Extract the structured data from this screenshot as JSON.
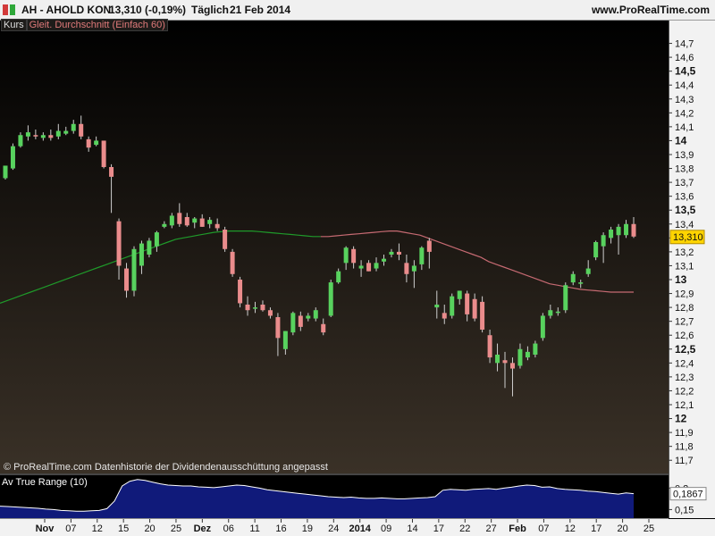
{
  "header": {
    "symbol": "AH - AHOLD KON",
    "quote": "13,310 (-0,19%)",
    "period": "Täglich",
    "date": "21 Feb 2014",
    "site": "www.ProRealTime.com"
  },
  "legend": {
    "price_label": "Kurs",
    "ma_label": "Gleit. Durchschnitt (Einfach 60)"
  },
  "footer": {
    "copyright": "© ProRealTime.com  Datenhistorie der Dividendenausschüttung angepasst"
  },
  "colors": {
    "up": "#58d25e",
    "down": "#ea8c8c",
    "ma_green": "#1f9a2a",
    "ma_red": "#c66a72",
    "highlight": "#ffd400",
    "atr_fill": "#101a7a",
    "atr_line": "#ffffff"
  },
  "chart_data": [
    {
      "type": "candlestick",
      "ylim": [
        11.65,
        14.8
      ],
      "y_ticks": [
        "14,7",
        "14,6",
        "14,5",
        "14,4",
        "14,3",
        "14,2",
        "14,1",
        "14",
        "13,9",
        "13,8",
        "13,7",
        "13,6",
        "13,5",
        "13,4",
        "13,3",
        "13,2",
        "13,1",
        "13",
        "12,9",
        "12,8",
        "12,7",
        "12,6",
        "12,5",
        "12,4",
        "12,3",
        "12,2",
        "12,1",
        "12",
        "11,9",
        "11,8",
        "11,7"
      ],
      "major_ticks": [
        "14,5",
        "14",
        "13,5",
        "13",
        "12,5",
        "12"
      ],
      "last_price": "13,310",
      "last_price_value": 13.31,
      "x_labels": [
        "Nov",
        "07",
        "12",
        "15",
        "20",
        "25",
        "Dez",
        "06",
        "11",
        "16",
        "19",
        "24",
        "2014",
        "09",
        "14",
        "17",
        "22",
        "27",
        "Feb",
        "07",
        "12",
        "17",
        "20",
        "25"
      ],
      "major_x_labels": [
        "Nov",
        "Dez",
        "2014",
        "Feb"
      ],
      "candles": [
        {
          "o": 13.73,
          "h": 13.82,
          "l": 13.72,
          "c": 13.82
        },
        {
          "o": 13.8,
          "h": 13.98,
          "l": 13.79,
          "c": 13.96
        },
        {
          "o": 13.96,
          "h": 14.06,
          "l": 13.95,
          "c": 14.04
        },
        {
          "o": 14.03,
          "h": 14.11,
          "l": 14.0,
          "c": 14.06
        },
        {
          "o": 14.04,
          "h": 14.08,
          "l": 14.01,
          "c": 14.03
        },
        {
          "o": 14.02,
          "h": 14.06,
          "l": 14.0,
          "c": 14.04
        },
        {
          "o": 14.04,
          "h": 14.08,
          "l": 14.0,
          "c": 14.02
        },
        {
          "o": 14.03,
          "h": 14.12,
          "l": 14.01,
          "c": 14.07
        },
        {
          "o": 14.05,
          "h": 14.1,
          "l": 14.04,
          "c": 14.07
        },
        {
          "o": 14.07,
          "h": 14.15,
          "l": 14.05,
          "c": 14.12
        },
        {
          "o": 14.12,
          "h": 14.18,
          "l": 14.01,
          "c": 14.03
        },
        {
          "o": 14.01,
          "h": 14.03,
          "l": 13.92,
          "c": 13.95
        },
        {
          "o": 13.97,
          "h": 14.03,
          "l": 13.96,
          "c": 14.0
        },
        {
          "o": 14.0,
          "h": 14.0,
          "l": 13.8,
          "c": 13.81
        },
        {
          "o": 13.81,
          "h": 13.83,
          "l": 13.48,
          "c": 13.74
        },
        {
          "o": 13.42,
          "h": 13.44,
          "l": 13.0,
          "c": 13.1
        },
        {
          "o": 13.08,
          "h": 13.12,
          "l": 12.87,
          "c": 12.92
        },
        {
          "o": 12.92,
          "h": 13.24,
          "l": 12.88,
          "c": 13.22
        },
        {
          "o": 13.1,
          "h": 13.28,
          "l": 13.04,
          "c": 13.26
        },
        {
          "o": 13.18,
          "h": 13.3,
          "l": 13.16,
          "c": 13.28
        },
        {
          "o": 13.24,
          "h": 13.35,
          "l": 13.2,
          "c": 13.34
        },
        {
          "o": 13.38,
          "h": 13.42,
          "l": 13.37,
          "c": 13.4
        },
        {
          "o": 13.39,
          "h": 13.48,
          "l": 13.37,
          "c": 13.46
        },
        {
          "o": 13.48,
          "h": 13.55,
          "l": 13.38,
          "c": 13.4
        },
        {
          "o": 13.45,
          "h": 13.48,
          "l": 13.38,
          "c": 13.39
        },
        {
          "o": 13.41,
          "h": 13.45,
          "l": 13.37,
          "c": 13.44
        },
        {
          "o": 13.44,
          "h": 13.47,
          "l": 13.38,
          "c": 13.38
        },
        {
          "o": 13.4,
          "h": 13.45,
          "l": 13.37,
          "c": 13.43
        },
        {
          "o": 13.4,
          "h": 13.44,
          "l": 13.35,
          "c": 13.37
        },
        {
          "o": 13.36,
          "h": 13.38,
          "l": 13.2,
          "c": 13.22
        },
        {
          "o": 13.2,
          "h": 13.22,
          "l": 13.02,
          "c": 13.04
        },
        {
          "o": 13.0,
          "h": 13.02,
          "l": 12.8,
          "c": 12.83
        },
        {
          "o": 12.82,
          "h": 12.88,
          "l": 12.74,
          "c": 12.78
        },
        {
          "o": 12.8,
          "h": 12.84,
          "l": 12.76,
          "c": 12.8
        },
        {
          "o": 12.82,
          "h": 12.85,
          "l": 12.77,
          "c": 12.78
        },
        {
          "o": 12.78,
          "h": 12.8,
          "l": 12.72,
          "c": 12.74
        },
        {
          "o": 12.73,
          "h": 12.76,
          "l": 12.45,
          "c": 12.58
        },
        {
          "o": 12.5,
          "h": 12.63,
          "l": 12.46,
          "c": 12.63
        },
        {
          "o": 12.62,
          "h": 12.77,
          "l": 12.6,
          "c": 12.76
        },
        {
          "o": 12.74,
          "h": 12.77,
          "l": 12.63,
          "c": 12.66
        },
        {
          "o": 12.72,
          "h": 12.76,
          "l": 12.7,
          "c": 12.74
        },
        {
          "o": 12.72,
          "h": 12.8,
          "l": 12.7,
          "c": 12.78
        },
        {
          "o": 12.68,
          "h": 12.72,
          "l": 12.6,
          "c": 12.62
        },
        {
          "o": 12.74,
          "h": 13.0,
          "l": 12.73,
          "c": 12.98
        },
        {
          "o": 12.98,
          "h": 13.08,
          "l": 12.97,
          "c": 13.06
        },
        {
          "o": 13.12,
          "h": 13.24,
          "l": 13.07,
          "c": 13.23
        },
        {
          "o": 13.22,
          "h": 13.24,
          "l": 13.08,
          "c": 13.12
        },
        {
          "o": 13.08,
          "h": 13.14,
          "l": 13.02,
          "c": 13.1
        },
        {
          "o": 13.12,
          "h": 13.14,
          "l": 13.06,
          "c": 13.06
        },
        {
          "o": 13.08,
          "h": 13.16,
          "l": 13.06,
          "c": 13.12
        },
        {
          "o": 13.13,
          "h": 13.18,
          "l": 13.1,
          "c": 13.15
        },
        {
          "o": 13.18,
          "h": 13.22,
          "l": 13.16,
          "c": 13.2
        },
        {
          "o": 13.2,
          "h": 13.26,
          "l": 13.14,
          "c": 13.18
        },
        {
          "o": 13.12,
          "h": 13.18,
          "l": 12.98,
          "c": 13.04
        },
        {
          "o": 13.06,
          "h": 13.14,
          "l": 12.94,
          "c": 13.1
        },
        {
          "o": 13.11,
          "h": 13.24,
          "l": 13.07,
          "c": 13.23
        },
        {
          "o": 13.28,
          "h": 13.3,
          "l": 13.08,
          "c": 13.2
        },
        {
          "o": 12.8,
          "h": 12.92,
          "l": 12.72,
          "c": 12.82
        },
        {
          "o": 12.76,
          "h": 12.82,
          "l": 12.68,
          "c": 12.72
        },
        {
          "o": 12.74,
          "h": 12.9,
          "l": 12.72,
          "c": 12.88
        },
        {
          "o": 12.86,
          "h": 12.92,
          "l": 12.82,
          "c": 12.92
        },
        {
          "o": 12.9,
          "h": 12.92,
          "l": 12.7,
          "c": 12.75
        },
        {
          "o": 12.86,
          "h": 12.9,
          "l": 12.7,
          "c": 12.72
        },
        {
          "o": 12.84,
          "h": 12.88,
          "l": 12.62,
          "c": 12.64
        },
        {
          "o": 12.6,
          "h": 12.64,
          "l": 12.4,
          "c": 12.44
        },
        {
          "o": 12.4,
          "h": 12.54,
          "l": 12.34,
          "c": 12.46
        },
        {
          "o": 12.42,
          "h": 12.48,
          "l": 12.22,
          "c": 12.4
        },
        {
          "o": 12.4,
          "h": 12.44,
          "l": 12.16,
          "c": 12.36
        },
        {
          "o": 12.38,
          "h": 12.54,
          "l": 12.36,
          "c": 12.5
        },
        {
          "o": 12.44,
          "h": 12.52,
          "l": 12.42,
          "c": 12.48
        },
        {
          "o": 12.46,
          "h": 12.56,
          "l": 12.44,
          "c": 12.54
        },
        {
          "o": 12.58,
          "h": 12.76,
          "l": 12.56,
          "c": 12.74
        },
        {
          "o": 12.74,
          "h": 12.82,
          "l": 12.72,
          "c": 12.78
        },
        {
          "o": 12.76,
          "h": 12.8,
          "l": 12.74,
          "c": 12.77
        },
        {
          "o": 12.78,
          "h": 12.98,
          "l": 12.76,
          "c": 12.96
        },
        {
          "o": 12.98,
          "h": 13.06,
          "l": 12.96,
          "c": 13.04
        },
        {
          "o": 12.97,
          "h": 13.0,
          "l": 12.94,
          "c": 12.98
        },
        {
          "o": 13.04,
          "h": 13.14,
          "l": 13.02,
          "c": 13.08
        },
        {
          "o": 13.16,
          "h": 13.28,
          "l": 13.14,
          "c": 13.27
        },
        {
          "o": 13.24,
          "h": 13.34,
          "l": 13.12,
          "c": 13.32
        },
        {
          "o": 13.3,
          "h": 13.38,
          "l": 13.26,
          "c": 13.36
        },
        {
          "o": 13.32,
          "h": 13.4,
          "l": 13.18,
          "c": 13.38
        },
        {
          "o": 13.32,
          "h": 13.43,
          "l": 13.3,
          "c": 13.4
        },
        {
          "o": 13.4,
          "h": 13.45,
          "l": 13.3,
          "c": 13.31
        }
      ],
      "moving_average": [
        12.83,
        12.85,
        12.87,
        12.89,
        12.91,
        12.93,
        12.95,
        12.97,
        12.99,
        13.01,
        13.03,
        13.05,
        13.07,
        13.09,
        13.11,
        13.13,
        13.15,
        13.17,
        13.19,
        13.21,
        13.23,
        13.25,
        13.27,
        13.29,
        13.3,
        13.31,
        13.32,
        13.33,
        13.34,
        13.345,
        13.35,
        13.35,
        13.35,
        13.35,
        13.345,
        13.34,
        13.335,
        13.33,
        13.325,
        13.32,
        13.315,
        13.31,
        13.31,
        13.31,
        13.315,
        13.32,
        13.325,
        13.33,
        13.335,
        13.34,
        13.345,
        13.35,
        13.35,
        13.34,
        13.33,
        13.32,
        13.3,
        13.28,
        13.26,
        13.24,
        13.22,
        13.2,
        13.18,
        13.16,
        13.13,
        13.11,
        13.09,
        13.07,
        13.05,
        13.03,
        13.01,
        12.99,
        12.97,
        12.96,
        12.95,
        12.94,
        12.93,
        12.925,
        12.92,
        12.915,
        12.91,
        12.91,
        12.91,
        12.91
      ],
      "ma_cross_index": 42
    },
    {
      "type": "area",
      "title": "Av True Range (10)",
      "last_value": "0,1867",
      "y_ticks": [
        "0,2",
        "0,15"
      ],
      "ylim": [
        0.13,
        0.23
      ],
      "values": [
        0.158,
        0.157,
        0.156,
        0.155,
        0.154,
        0.153,
        0.151,
        0.15,
        0.148,
        0.147,
        0.146,
        0.146,
        0.147,
        0.148,
        0.152,
        0.17,
        0.205,
        0.216,
        0.22,
        0.218,
        0.214,
        0.21,
        0.207,
        0.206,
        0.205,
        0.205,
        0.203,
        0.202,
        0.201,
        0.203,
        0.205,
        0.207,
        0.206,
        0.203,
        0.2,
        0.196,
        0.194,
        0.192,
        0.19,
        0.188,
        0.186,
        0.184,
        0.182,
        0.18,
        0.179,
        0.178,
        0.179,
        0.177,
        0.176,
        0.176,
        0.177,
        0.176,
        0.175,
        0.175,
        0.176,
        0.177,
        0.178,
        0.18,
        0.195,
        0.197,
        0.196,
        0.195,
        0.197,
        0.198,
        0.199,
        0.197,
        0.2,
        0.202,
        0.205,
        0.207,
        0.206,
        0.202,
        0.203,
        0.199,
        0.197,
        0.196,
        0.195,
        0.193,
        0.192,
        0.19,
        0.188,
        0.186,
        0.189,
        0.187
      ]
    }
  ]
}
